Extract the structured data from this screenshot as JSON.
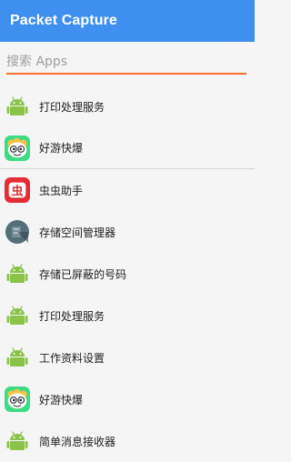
{
  "appbar": {
    "title": "Packet Capture"
  },
  "search": {
    "placeholder": "搜索 Apps",
    "value": ""
  },
  "apps": [
    {
      "label": "打印处理服务",
      "icon": "android-icon"
    },
    {
      "label": "好游快爆",
      "icon": "haoyou-kuaibao-icon"
    },
    {
      "label": "虫虫助手",
      "icon": "chongchong-icon"
    },
    {
      "label": "存储空间管理器",
      "icon": "storage-manager-icon"
    },
    {
      "label": "存储已屏蔽的号码",
      "icon": "android-icon"
    },
    {
      "label": "打印处理服务",
      "icon": "android-icon"
    },
    {
      "label": "工作资料设置",
      "icon": "android-icon"
    },
    {
      "label": "好游快爆",
      "icon": "haoyou-kuaibao-icon"
    },
    {
      "label": "简单消息接收器",
      "icon": "android-icon"
    }
  ],
  "colors": {
    "appbar": "#3f8ff0",
    "accent": "#ff6d2d",
    "android_green": "#8bc34a",
    "chongchong_red": "#e52c34",
    "haoyou_green": "#3ddc84"
  }
}
